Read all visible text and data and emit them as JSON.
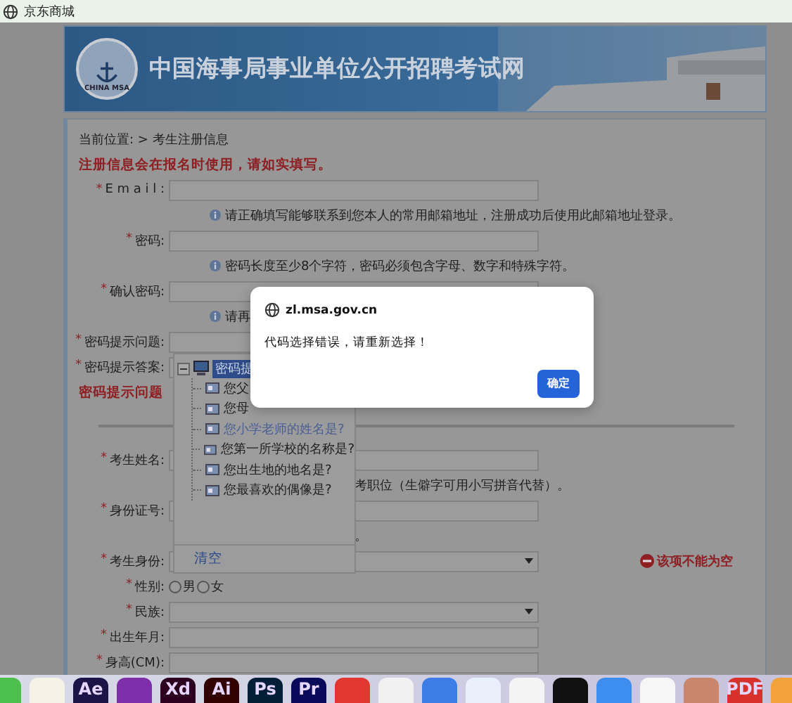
{
  "browser_tab": {
    "title": "京东商城"
  },
  "banner": {
    "title": "中国海事局事业单位公开招聘考试网",
    "emblem_text": "CHINA MSA"
  },
  "breadcrumb": "当前位置: > 考生注册信息",
  "form_rows": [
    {
      "kind": "note",
      "text": "注册信息会在报名时使用，请如实填写。"
    },
    {
      "kind": "text",
      "label": "E m a i l :",
      "mark": "*"
    },
    {
      "kind": "hint",
      "text": "请正确填写能够联系到您本人的常用邮箱地址，注册成功后使用此邮箱地址登录。",
      "icon": true
    },
    {
      "kind": "text",
      "label": "密码:",
      "mark": "*"
    },
    {
      "kind": "hint",
      "text": "密码长度至少8个字符，密码必须包含字母、数字和特殊字符。",
      "icon": true
    },
    {
      "kind": "text",
      "label": "确认密码:",
      "mark": "*"
    },
    {
      "kind": "hint",
      "text": "请再",
      "icon": true
    },
    {
      "kind": "text",
      "label": "密码提示问题:",
      "mark": "*"
    },
    {
      "kind": "text",
      "label": "密码提示答案:",
      "mark": "*"
    },
    {
      "kind": "note",
      "text": "密码提示问题"
    },
    {
      "kind": "divider"
    },
    {
      "kind": "text",
      "label": "考生姓名:",
      "mark": "*"
    },
    {
      "kind": "hint",
      "text": "考职位（生僻字可用小写拼音代替）。",
      "icon": false
    },
    {
      "kind": "text",
      "label": "身份证号:",
      "mark": "*"
    },
    {
      "kind": "hint",
      "text": "。",
      "icon": false
    },
    {
      "kind": "select",
      "label": "考生身份:",
      "mark": "*",
      "error": "该项不能为空"
    },
    {
      "kind": "radio",
      "label": "性别:",
      "mark": "*",
      "options": [
        {
          "label": "男",
          "selected": false
        },
        {
          "label": "女",
          "selected": false
        }
      ]
    },
    {
      "kind": "select",
      "label": "民族:",
      "mark": "*"
    },
    {
      "kind": "text",
      "label": "出生年月:",
      "mark": "*"
    },
    {
      "kind": "text",
      "label": "身高(CM):",
      "mark": "*"
    }
  ],
  "tree_popup": {
    "root": {
      "label": "密码提",
      "selected": true,
      "expanded": true,
      "children": [
        {
          "label": "您父",
          "hovered": false
        },
        {
          "label": "您母",
          "hovered": false
        },
        {
          "label": "您小学老师的姓名是?",
          "hovered": true
        },
        {
          "label": "您第一所学校的名称是?",
          "hovered": false
        },
        {
          "label": "您出生地的地名是?",
          "hovered": false
        },
        {
          "label": "您最喜欢的偶像是?",
          "hovered": false
        }
      ]
    },
    "clear_button": "清空"
  },
  "dialog": {
    "host": "zl.msa.gov.cn",
    "message": "代码选择错误，请重新选择！",
    "button": "确定"
  },
  "dock": [
    {
      "color": "#4cbf4c"
    },
    {
      "color": "#f7f2e6"
    },
    {
      "label": "Ae",
      "color": "#1c1446"
    },
    {
      "color": "#7d2ea8"
    },
    {
      "label": "Xd",
      "color": "#2e001f"
    },
    {
      "label": "Ai",
      "color": "#330000"
    },
    {
      "label": "Ps",
      "color": "#001e36"
    },
    {
      "label": "Pr",
      "color": "#0a0a5b"
    },
    {
      "color": "#e2372f"
    },
    {
      "color": "#f1f1f1"
    },
    {
      "color": "#3c7de8"
    },
    {
      "color": "#e9f0fb"
    },
    {
      "color": "#f4f4f4"
    },
    {
      "color": "#111111"
    },
    {
      "color": "#3d8ef0"
    },
    {
      "color": "#f6f6f6"
    },
    {
      "color": "#c9866a"
    },
    {
      "label": "PDF",
      "color": "#d8302a"
    },
    {
      "color": "#f2a23b"
    }
  ]
}
